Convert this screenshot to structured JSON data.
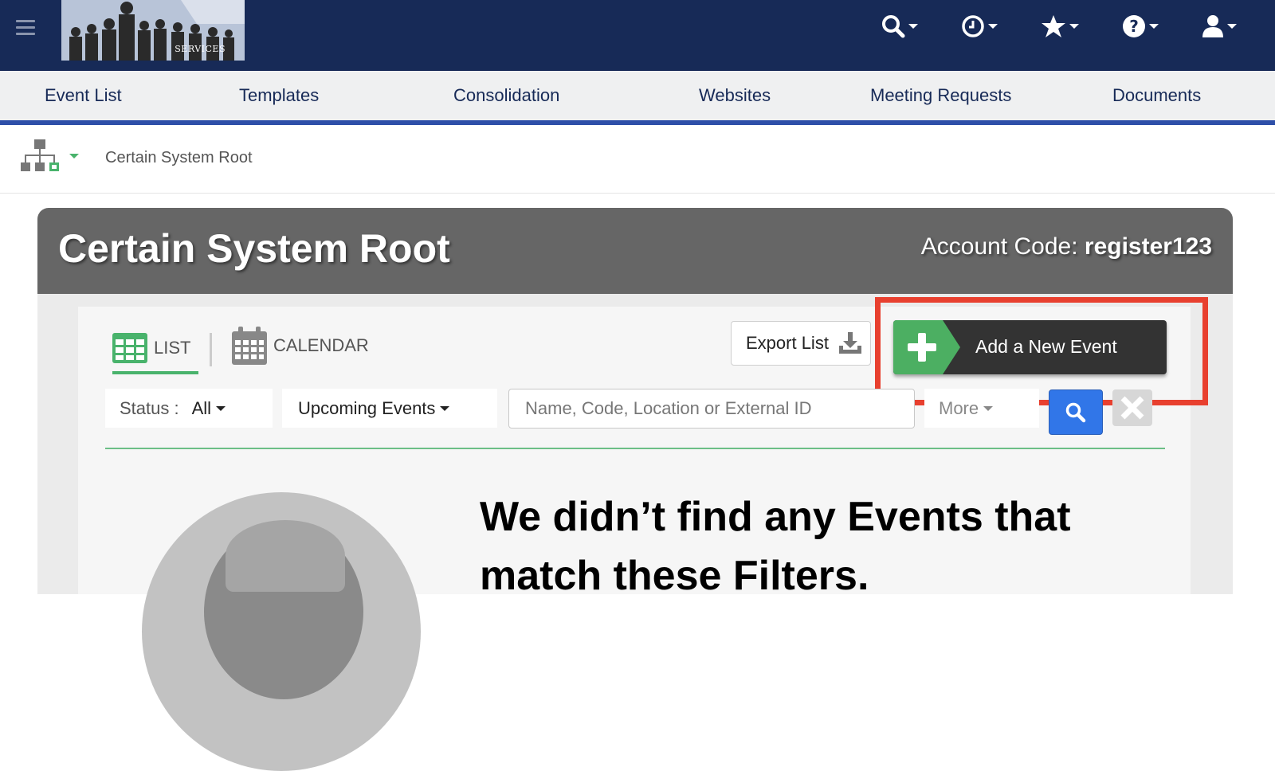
{
  "header": {
    "logo_text": "SERVICES",
    "icons": [
      "search-icon",
      "history-icon",
      "star-icon",
      "help-icon",
      "user-icon"
    ]
  },
  "nav": {
    "items": [
      {
        "label": "Event List"
      },
      {
        "label": "Templates"
      },
      {
        "label": "Consolidation"
      },
      {
        "label": "Websites"
      },
      {
        "label": "Meeting Requests"
      },
      {
        "label": "Documents"
      }
    ]
  },
  "breadcrumb": {
    "text": "Certain System Root"
  },
  "panel": {
    "title": "Certain System Root",
    "account_code_label": "Account Code:",
    "account_code_value": "register123"
  },
  "view_tabs": {
    "list_label": "LIST",
    "calendar_label": "CALENDAR",
    "active": "LIST"
  },
  "actions": {
    "export_label": "Export List",
    "add_event_label": "Add a New Event"
  },
  "filters": {
    "status_label": "Status :",
    "status_value": "All",
    "period_value": "Upcoming Events",
    "search_placeholder": "Name, Code, Location or External ID",
    "more_label": "More"
  },
  "empty_state": {
    "message": "We didn’t find any Events that match these Filters."
  },
  "colors": {
    "topbar": "#172a57",
    "nav_underline": "#2e4fa8",
    "accent_green": "#4caf62",
    "search_blue": "#3176e8",
    "highlight_red": "#e8402f"
  }
}
